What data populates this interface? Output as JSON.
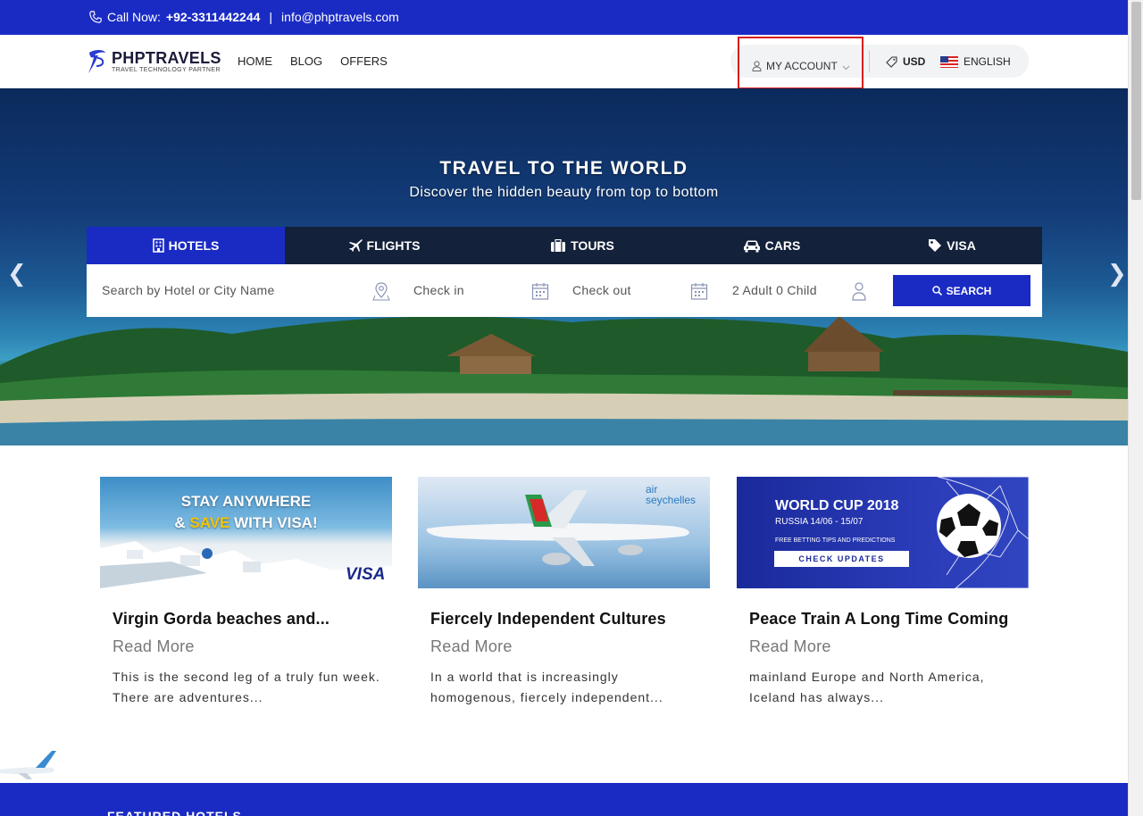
{
  "topbar": {
    "call_label": "Call Now:",
    "phone": "+92-3311442244",
    "separator": "|",
    "email": "info@phptravels.com"
  },
  "header": {
    "logo_name": "PHPTRAVELS",
    "logo_tagline": "TRAVEL TECHNOLOGY PARTNER",
    "nav": [
      "HOME",
      "BLOG",
      "OFFERS"
    ],
    "account_label": "MY ACCOUNT",
    "currency": "USD",
    "language": "ENGLISH"
  },
  "hero": {
    "title": "TRAVEL TO THE WORLD",
    "subtitle": "Discover the hidden beauty from top to bottom",
    "tabs": [
      "HOTELS",
      "FLIGHTS",
      "TOURS",
      "CARS",
      "VISA"
    ],
    "active_tab": "HOTELS",
    "search": {
      "destination_placeholder": "Search by Hotel or City Name",
      "checkin_placeholder": "Check in",
      "checkout_placeholder": "Check out",
      "guests": "2 Adult 0 Child",
      "button": "SEARCH"
    }
  },
  "banners": {
    "visa_line1": "STAY ANYWHERE",
    "visa_line2_pre": "& ",
    "visa_line2_hl": "SAVE",
    "visa_line2_post": " WITH VISA!",
    "visa_brand": "VISA",
    "air_brand": "air seychelles",
    "wc_title": "WORLD CUP 2018",
    "wc_dates": "RUSSIA 14/06 - 15/07",
    "wc_tips": "FREE BETTING TIPS AND PREDICTIONS",
    "wc_button": "CHECK UPDATES"
  },
  "cards": [
    {
      "title": "Virgin Gorda beaches and...",
      "read_more": "Read More",
      "desc": "This is the second leg of a truly fun week. There are adventures..."
    },
    {
      "title": "Fiercely Independent Cultures",
      "read_more": "Read More",
      "desc": "In a world that is increasingly homogenous, fiercely independent..."
    },
    {
      "title": "Peace Train A Long Time Coming",
      "read_more": "Read More",
      "desc": " mainland Europe and North America, Iceland has always..."
    }
  ],
  "footer": {
    "section_title": "FEATURED HOTELS"
  },
  "colors": {
    "brand_blue": "#1a2bc4",
    "tab_dark": "#14213a",
    "highlight_red": "#d81d1d",
    "visa_yellow": "#f5c400"
  }
}
